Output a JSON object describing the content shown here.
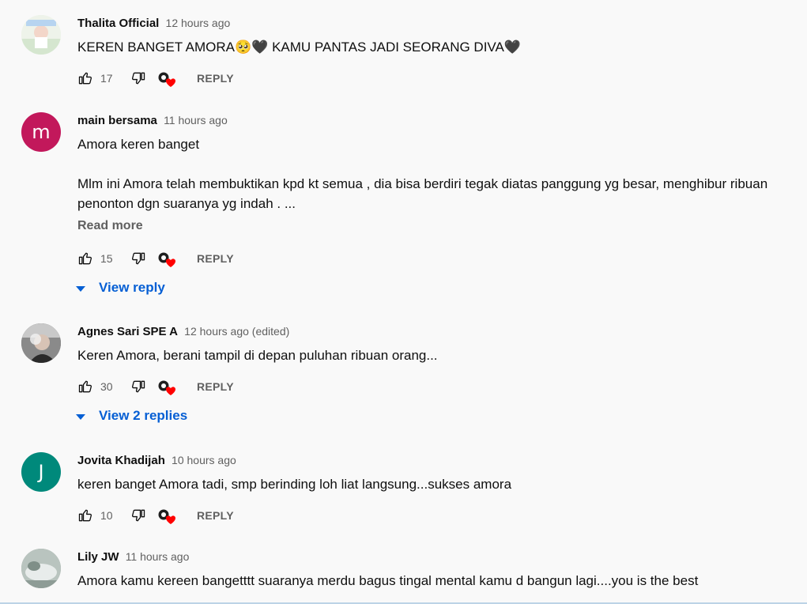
{
  "comments": [
    {
      "author": "Thalita Official",
      "time": "12 hours ago",
      "lines": [
        "KEREN BANGET AMORA🥺🖤 KAMU PANTAS JADI SEORANG DIVA🖤"
      ],
      "likes": "17",
      "reply_label": "REPLY",
      "avatar_color": "#dfe9d5"
    },
    {
      "author": "main bersama",
      "time": "11 hours ago",
      "avatar_letter": "m",
      "avatar_color": "#c2185b",
      "lines": [
        "Amora keren banget",
        "",
        "Mlm ini Amora telah membuktikan kpd kt semua , dia bisa berdiri tegak diatas panggung yg besar,  menghibur ribuan",
        "penonton dgn suaranya yg indah . ..."
      ],
      "read_more": "Read more",
      "likes": "15",
      "reply_label": "REPLY",
      "view_replies": "View reply"
    },
    {
      "author": "Agnes Sari SPE A",
      "time": "12 hours ago (edited)",
      "avatar_color": "#6b6b6b",
      "lines": [
        "Keren Amora, berani tampil di depan puluhan ribuan orang..."
      ],
      "likes": "30",
      "reply_label": "REPLY",
      "view_replies": "View 2 replies"
    },
    {
      "author": "Jovita Khadijah",
      "time": "10 hours ago",
      "avatar_letter": "J",
      "avatar_color": "#00897b",
      "lines": [
        "keren banget Amora tadi, smp berinding loh liat langsung...sukses amora"
      ],
      "likes": "10",
      "reply_label": "REPLY"
    },
    {
      "author": "Lily JW",
      "time": "11 hours ago",
      "avatar_color": "#9aa7a1",
      "lines": [
        "Amora kamu kereen bangetttt suaranya merdu bagus tingal mental kamu d bangun lagi....you is the best"
      ]
    }
  ],
  "icons": {
    "like": "thumbs-up-icon",
    "dislike": "thumbs-down-icon",
    "creator_heart": "creator-heart-icon",
    "expand": "chevron-down-icon"
  },
  "colors": {
    "link": "#065fd4",
    "heart": "#ff0000",
    "muted": "#606060"
  }
}
